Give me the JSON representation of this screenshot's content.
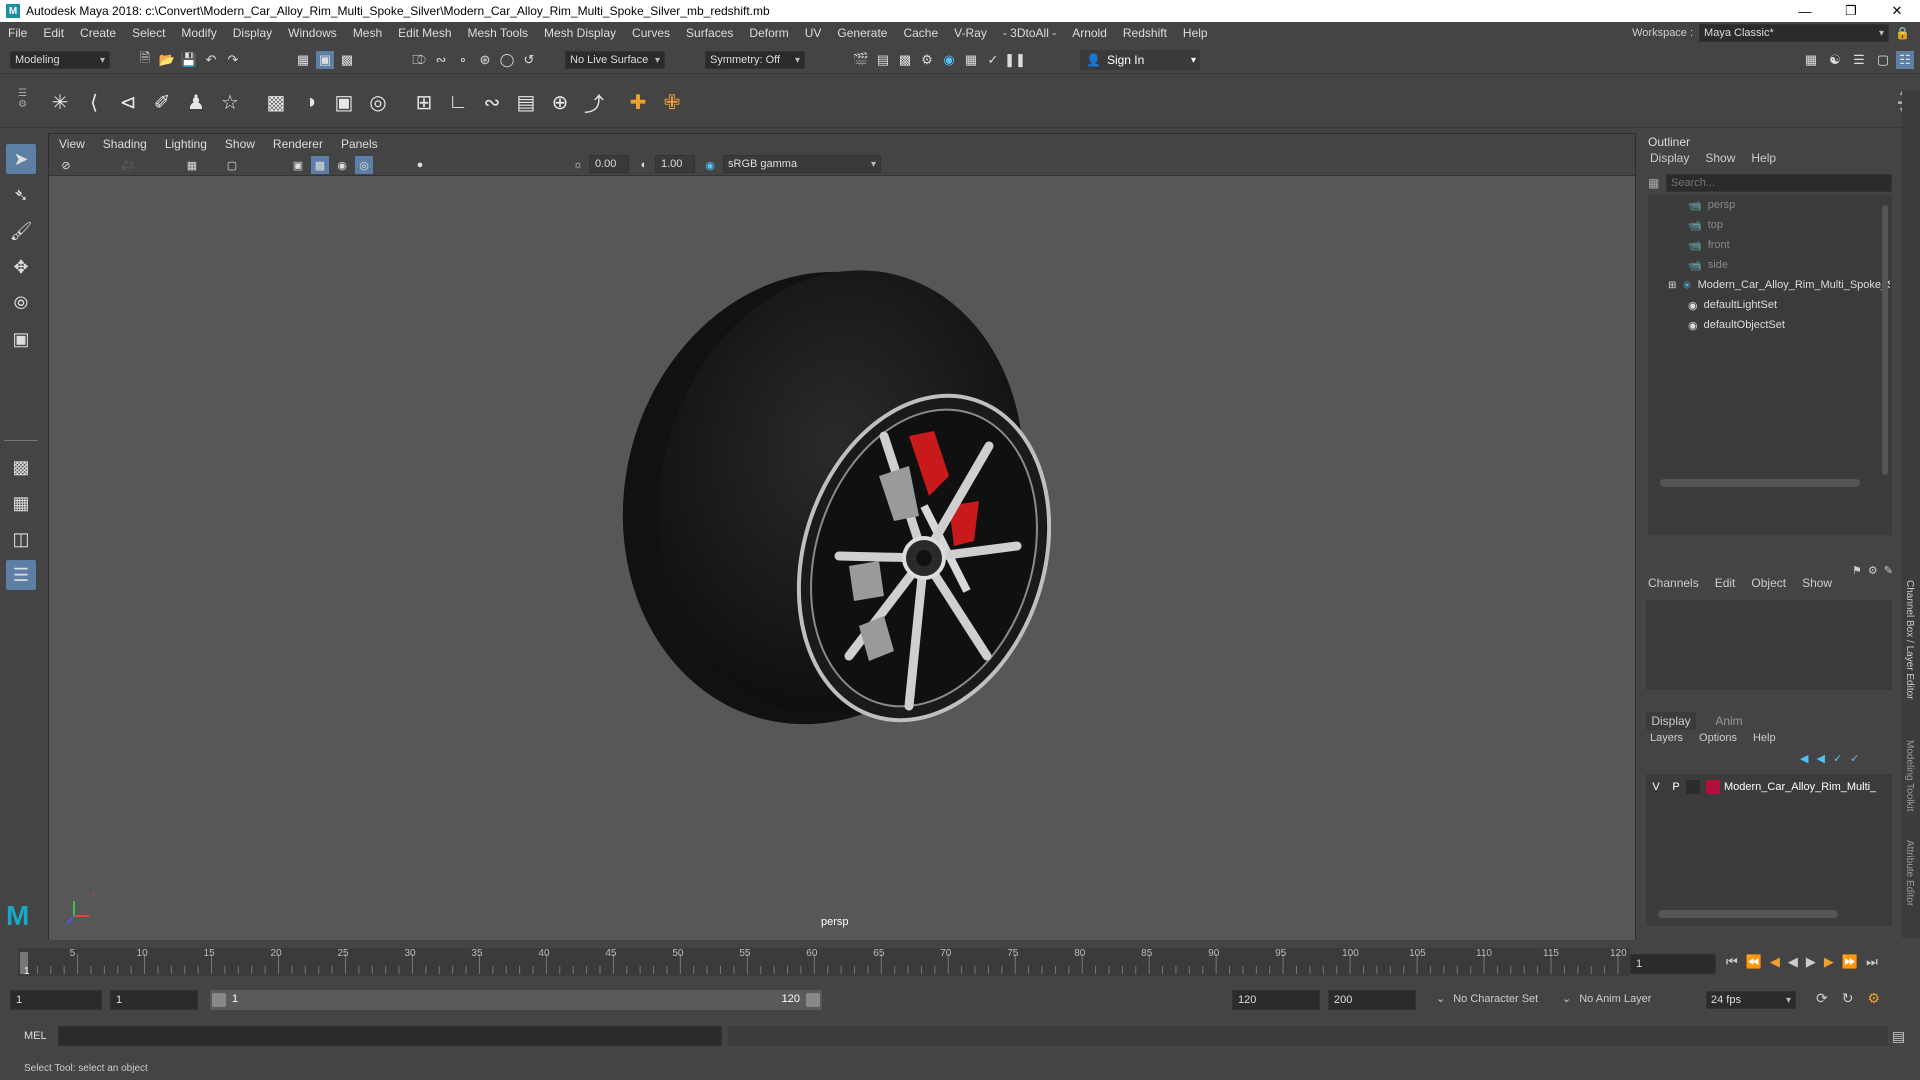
{
  "window": {
    "title": "Autodesk Maya 2018: c:\\Convert\\Modern_Car_Alloy_Rim_Multi_Spoke_Silver\\Modern_Car_Alloy_Rim_Multi_Spoke_Silver_mb_redshift.mb",
    "logo": "M"
  },
  "menu": [
    "File",
    "Edit",
    "Create",
    "Select",
    "Modify",
    "Display",
    "Windows",
    "Mesh",
    "Edit Mesh",
    "Mesh Tools",
    "Mesh Display",
    "Curves",
    "Surfaces",
    "Deform",
    "UV",
    "Generate",
    "Cache",
    "V-Ray",
    "- 3DtoAll -",
    "Arnold",
    "Redshift",
    "Help"
  ],
  "workspace": {
    "label": "Workspace :",
    "value": "Maya Classic*"
  },
  "status": {
    "mode": "Modeling",
    "live_surface": "No Live Surface",
    "symmetry": "Symmetry: Off",
    "sign_in": "Sign In"
  },
  "viewport": {
    "menus": [
      "View",
      "Shading",
      "Lighting",
      "Show",
      "Renderer",
      "Panels"
    ],
    "exposure": "0.00",
    "gamma": "1.00",
    "color_space": "sRGB gamma",
    "camera_label": "persp"
  },
  "outliner": {
    "title": "Outliner",
    "menus": [
      "Display",
      "Show",
      "Help"
    ],
    "search_placeholder": "Search...",
    "items": [
      "persp",
      "top",
      "front",
      "side",
      "Modern_Car_Alloy_Rim_Multi_Spoke_Silv",
      "defaultLightSet",
      "defaultObjectSet"
    ]
  },
  "channel_box": {
    "menus": [
      "Channels",
      "Edit",
      "Object",
      "Show"
    ]
  },
  "layer_editor": {
    "tabs": [
      "Display",
      "Anim"
    ],
    "menus": [
      "Layers",
      "Options",
      "Help"
    ],
    "layer": {
      "v": "V",
      "p": "P",
      "name": "Modern_Car_Alloy_Rim_Multi_",
      "color": "#b0103a"
    }
  },
  "side_tabs": [
    "Channel Box / Layer Editor",
    "Modeling Toolkit",
    "Attribute Editor"
  ],
  "timeline": {
    "ticks": [
      "5",
      "10",
      "15",
      "20",
      "25",
      "30",
      "35",
      "40",
      "45",
      "50",
      "55",
      "60",
      "65",
      "70",
      "75",
      "80",
      "85",
      "90",
      "95",
      "100",
      "105",
      "110",
      "115",
      "120"
    ],
    "current_frame_marker": "1",
    "current_frame": "1"
  },
  "range": {
    "start": "1",
    "playback_start": "1",
    "slider_start": "1",
    "slider_end": "120",
    "playback_end": "120",
    "end": "200",
    "character_set": "No Character Set",
    "anim_layer": "No Anim Layer",
    "fps": "24 fps"
  },
  "cmdline": {
    "label": "MEL"
  },
  "help_line": "Select Tool: select an object"
}
